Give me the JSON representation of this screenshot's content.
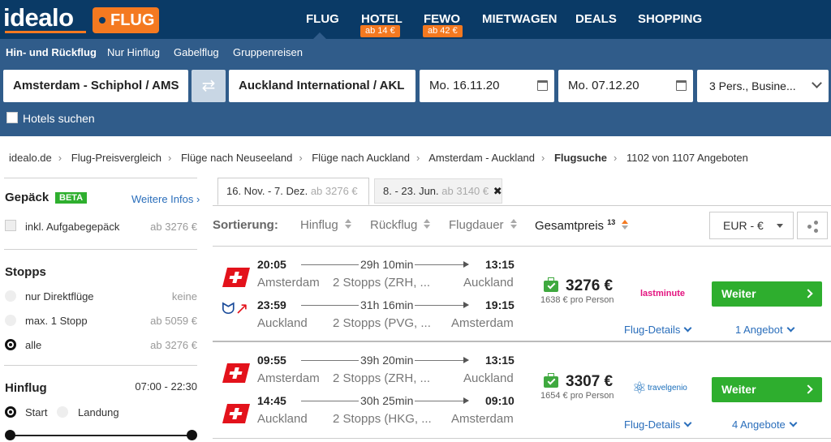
{
  "header": {
    "logo": "idealo",
    "product_tag": "FLUG",
    "nav": [
      {
        "label": "FLUG",
        "badge": ""
      },
      {
        "label": "HOTEL",
        "badge": "ab 14 €"
      },
      {
        "label": "FEWO",
        "badge": "ab 42 €"
      },
      {
        "label": "MIETWAGEN",
        "badge": ""
      },
      {
        "label": "DEALS",
        "badge": ""
      },
      {
        "label": "SHOPPING",
        "badge": ""
      }
    ]
  },
  "search": {
    "trip_types": [
      "Hin- und Rückflug",
      "Nur Hinflug",
      "Gabelflug",
      "Gruppenreisen"
    ],
    "origin": "Amsterdam - Schiphol / AMS",
    "destination": "Auckland International / AKL",
    "depart_date": "Mo. 16.11.20",
    "return_date": "Mo. 07.12.20",
    "passengers": "3 Pers., Busine...",
    "hotels_label": "Hotels suchen"
  },
  "breadcrumb": [
    "idealo.de",
    "Flug-Preisvergleich",
    "Flüge nach Neuseeland",
    "Flüge nach Auckland",
    "Amsterdam - Auckland",
    "Flugsuche"
  ],
  "result_count": "1102 von 1107 Angeboten",
  "sidebar": {
    "baggage_title": "Gepäck",
    "beta": "BETA",
    "more_info": "Weitere Infos ›",
    "baggage_option": "inkl. Aufgabegepäck",
    "baggage_price": "ab 3276 €",
    "stops_title": "Stopps",
    "stops": [
      {
        "label": "nur Direktflüge",
        "value": "keine"
      },
      {
        "label": "max. 1 Stopp",
        "value": "ab 5059 €"
      },
      {
        "label": "alle",
        "value": "ab 3276 €"
      }
    ],
    "outbound_title": "Hinflug",
    "outbound_range": "07:00 - 22:30",
    "start_label": "Start",
    "landing_label": "Landung"
  },
  "date_tabs": [
    {
      "label": "16. Nov. - 7. Dez.",
      "price": "ab 3276 €"
    },
    {
      "label": "8. - 23. Jun.",
      "price": "ab 3140 €"
    }
  ],
  "sort": {
    "label": "Sortierung:",
    "options": [
      "Hinflug",
      "Rückflug",
      "Flugdauer",
      "Gesamtpreis"
    ],
    "superscript": "13",
    "currency": "EUR - €"
  },
  "results": [
    {
      "outbound": {
        "dep": "20:05",
        "dur": "29h 10min",
        "arr": "13:15",
        "from": "Amsterdam",
        "stops": "2 Stopps (ZRH, ...",
        "to": "Auckland"
      },
      "inbound": {
        "dep": "23:59",
        "dur": "31h 16min",
        "arr": "19:15",
        "from": "Auckland",
        "stops": "2 Stopps (PVG, ...",
        "to": "Amsterdam"
      },
      "price": "3276 €",
      "per_person": "1638 € pro Person",
      "provider": "lastminute",
      "button": "Weiter",
      "details": "Flug-Details",
      "offers": "1 Angebot"
    },
    {
      "outbound": {
        "dep": "09:55",
        "dur": "39h 20min",
        "arr": "13:15",
        "from": "Amsterdam",
        "stops": "2 Stopps (ZRH, ...",
        "to": "Auckland"
      },
      "inbound": {
        "dep": "14:45",
        "dur": "30h 25min",
        "arr": "09:10",
        "from": "Auckland",
        "stops": "2 Stopps (HKG, ...",
        "to": "Amsterdam"
      },
      "price": "3307 €",
      "per_person": "1654 € pro Person",
      "provider": "travelgenio",
      "button": "Weiter",
      "details": "Flug-Details",
      "offers": "4 Angebote"
    }
  ],
  "colors": {
    "header_bg": "#0a3a66",
    "panel_bg": "#305c8a",
    "accent": "#f47920",
    "cta": "#2eae2e",
    "link": "#2a6ebb"
  }
}
